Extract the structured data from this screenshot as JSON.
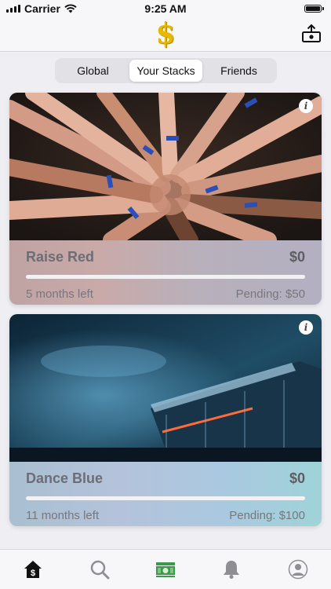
{
  "status_bar": {
    "carrier": "Carrier",
    "time": "9:25 AM"
  },
  "nav": {
    "logo": "$",
    "share_icon": "share-money-icon"
  },
  "segments": {
    "items": [
      "Global",
      "Your Stacks",
      "Friends"
    ],
    "selected": "Your Stacks"
  },
  "cards": [
    {
      "name": "Raise Red",
      "amount": "$0",
      "time_left": "5 months left",
      "pending": "Pending: $50",
      "progress": 0,
      "image": "hands-together-photo",
      "info_icon": "info-icon"
    },
    {
      "name": "Dance Blue",
      "amount": "$0",
      "time_left": "11 months left",
      "pending": "Pending: $100",
      "progress": 0,
      "image": "concert-stage-photo",
      "info_icon": "info-icon"
    }
  ],
  "tabs": [
    {
      "icon": "home-dollar-icon",
      "active": true
    },
    {
      "icon": "search-icon",
      "active": false
    },
    {
      "icon": "cash-icon",
      "active": false
    },
    {
      "icon": "bell-icon",
      "active": false
    },
    {
      "icon": "profile-icon",
      "active": false
    }
  ],
  "colors": {
    "accent_gold": "#e6b800",
    "cash_green": "#3a9a4a"
  }
}
